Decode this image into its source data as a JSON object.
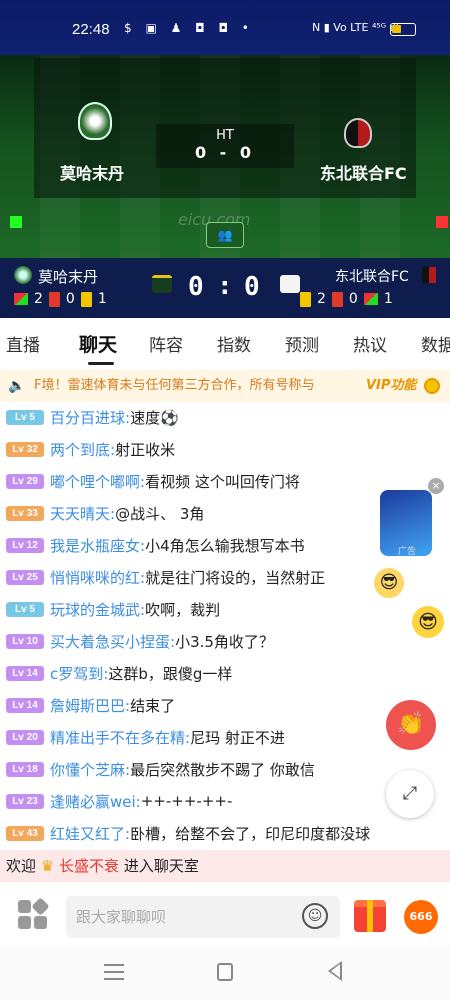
{
  "status_bar": {
    "time": "22:48",
    "left_icons": "$ ▣ ♟ ◘ ◘ •",
    "right_icons": "N ▮ Vo LTE ⁴⁵ᴳ ıll"
  },
  "match": {
    "home_team": "莫哈末丹",
    "away_team": "东北联合FC",
    "period": "HT",
    "score_text": "0 - 0",
    "watermark": "eicu.com",
    "home_score": "0",
    "away_score": "0",
    "colon": ":",
    "home_corners": "2",
    "home_red_cards": "0",
    "home_yellow_cards": "1",
    "away_yellow_cards": "2",
    "away_red_cards": "0",
    "away_corners": "1"
  },
  "tabs": [
    "直播",
    "聊天",
    "阵容",
    "指数",
    "预测",
    "热议",
    "数据"
  ],
  "active_tab": "聊天",
  "notice": {
    "text": "F境！雷速体育未与任何第三方合作，所有号称与",
    "vip": "VIP功能"
  },
  "chat_messages": [
    {
      "level": "Lv 5",
      "color": "blue",
      "nick": "百分百进球:",
      "text": "速度⚽"
    },
    {
      "level": "Lv 32",
      "color": "orange",
      "nick": "两个到底:",
      "text": "射正收米"
    },
    {
      "level": "Lv 29",
      "color": "purple",
      "nick": "嘟个哩个嘟啊:",
      "text": "看视频 这个叫回传门将"
    },
    {
      "level": "Lv 33",
      "color": "orange",
      "nick": "天天晴天:",
      "text": "@战斗、 3角"
    },
    {
      "level": "Lv 12",
      "color": "purple",
      "nick": "我是水瓶座女:",
      "text": "小4角怎么输我想写本书"
    },
    {
      "level": "Lv 25",
      "color": "purple",
      "nick": "悄悄咪咪的红:",
      "text": "就是往门将设的，当然射正"
    },
    {
      "level": "Lv 5",
      "color": "blue",
      "nick": "玩球的金城武:",
      "text": "吹啊，裁判"
    },
    {
      "level": "Lv 10",
      "color": "purple",
      "nick": "买大着急买小捏蛋:",
      "text": "小3.5角收了？"
    },
    {
      "level": "Lv 14",
      "color": "purple",
      "nick": "c罗驾到:",
      "text": "这群b，跟傻g一样"
    },
    {
      "level": "Lv 14",
      "color": "purple",
      "nick": "詹姆斯巴巴:",
      "text": "结束了"
    },
    {
      "level": "Lv 20",
      "color": "purple",
      "nick": "精准出手不在多在精:",
      "text": "尼玛 射正不进"
    },
    {
      "level": "Lv 18",
      "color": "purple",
      "nick": "你懂个芝麻:",
      "text": "最后突然散步不踢了 你敢信"
    },
    {
      "level": "Lv 23",
      "color": "purple",
      "nick": "逢赌必赢wei:",
      "text": "++-++-++-"
    },
    {
      "level": "Lv 43",
      "color": "orange",
      "nick": "红娃又红了:",
      "text": "卧槽，给整不会了，印尼印度都没球"
    }
  ],
  "ad": {
    "close": "×",
    "tag": "广告"
  },
  "welcome": {
    "prefix": "欢迎",
    "crown": "♛",
    "name": "长盛不衰",
    "suffix": "进入聊天室"
  },
  "input": {
    "placeholder": "跟大家聊聊呗"
  },
  "s666": "666",
  "icons": {
    "clap": "👏",
    "expand": "⤢",
    "smile": "☺",
    "speaker": "🔈",
    "group": "👥",
    "cool1": "😎",
    "cool2": "😎"
  }
}
